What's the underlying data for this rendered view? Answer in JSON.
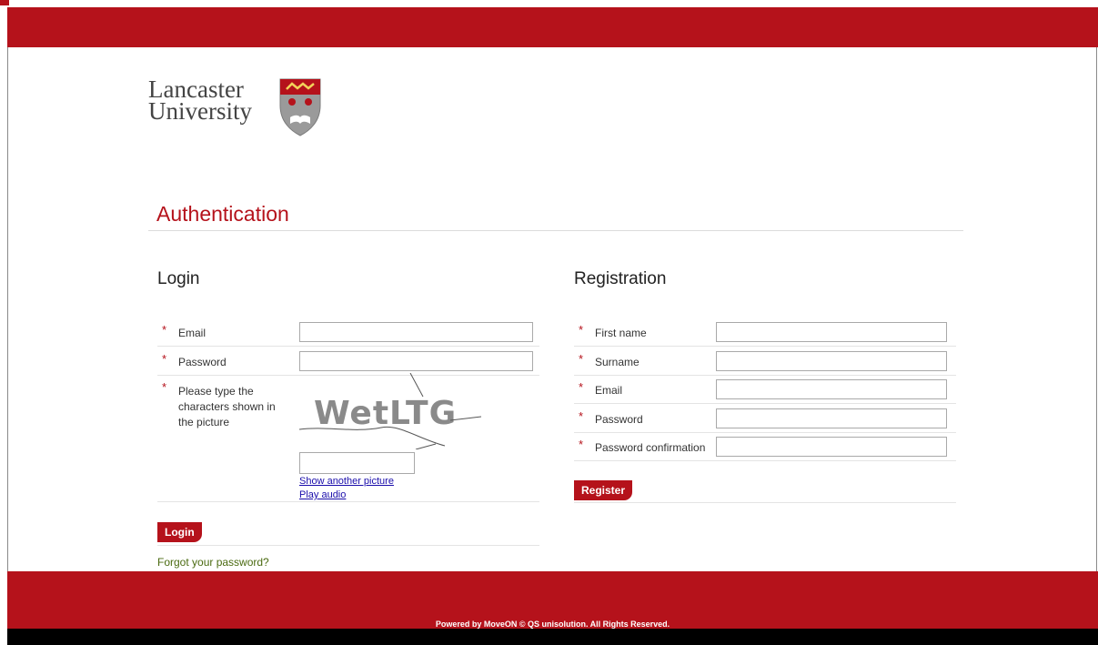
{
  "header": {
    "brand_color": "#b5121b"
  },
  "logo": {
    "line1": "Lancaster",
    "line2": "University",
    "crest_icon": "lancaster-crest-icon"
  },
  "page": {
    "title": "Authentication"
  },
  "login": {
    "heading": "Login",
    "email_label": "Email",
    "password_label": "Password",
    "captcha_label": "Please type the characters shown in the picture",
    "captcha_text": "WetLTG",
    "show_another_picture": "Show another picture",
    "play_audio": "Play audio",
    "login_button": "Login",
    "forgot_password": "Forgot your password?"
  },
  "registration": {
    "heading": "Registration",
    "first_name_label": "First name",
    "surname_label": "Surname",
    "email_label": "Email",
    "password_label": "Password",
    "password_confirmation_label": "Password confirmation",
    "register_button": "Register"
  },
  "required_marker": "*",
  "footer": {
    "text": "Powered by MoveON © QS unisolution. All Rights Reserved."
  }
}
